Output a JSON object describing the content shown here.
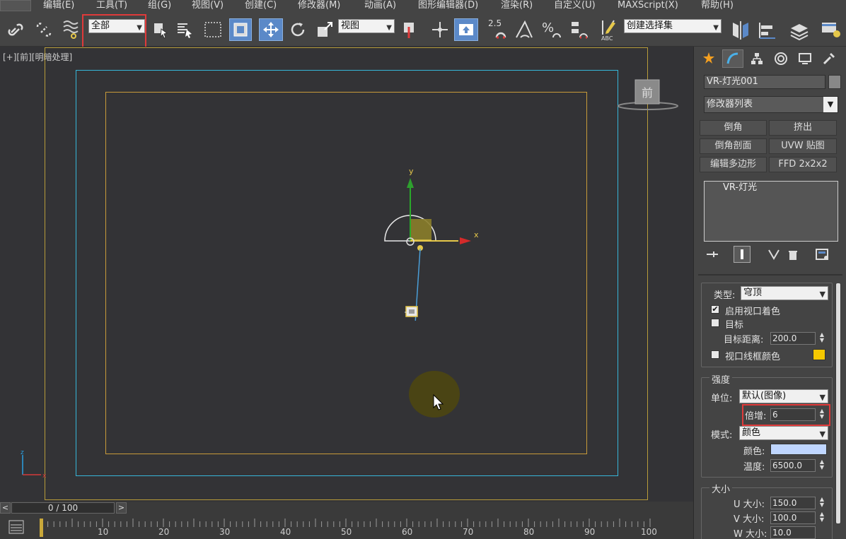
{
  "menu": {
    "items": [
      "编辑(E)",
      "工具(T)",
      "组(G)",
      "视图(V)",
      "创建(C)",
      "修改器(M)",
      "动画(A)",
      "图形编辑器(D)",
      "渲染(R)",
      "自定义(U)",
      "MAXScript(X)",
      "帮助(H)"
    ]
  },
  "toolbar": {
    "selection_filter": "全部",
    "reference_coord": "视图",
    "angle_snap_label": "2.5",
    "percent_label": "%",
    "named_selection": "创建选择集",
    "abc_label": "ABC"
  },
  "viewport": {
    "label": "[+][前][明暗处理]",
    "viewcube_label": "前",
    "axis_x": "x",
    "axis_y": "y",
    "tripod_z": "z",
    "tripod_x": "x"
  },
  "timeslider": {
    "position": "0 / 100",
    "prev": "<",
    "next": ">"
  },
  "trackbar": {
    "ticks": [
      "10",
      "20",
      "30",
      "40",
      "50",
      "60",
      "70",
      "80",
      "90",
      "100"
    ]
  },
  "panel": {
    "object_name": "VR-灯光001",
    "modifier_list": "修改器列表",
    "buttons": [
      "倒角",
      "挤出",
      "倒角剖面",
      "UVW 贴图",
      "编辑多边形",
      "FFD 2x2x2"
    ],
    "stack_item": "VR-灯光",
    "params": {
      "type_label": "类型:",
      "type_value": "穹顶",
      "enable_viewport_shading": "启用视口着色",
      "target": "目标",
      "target_distance_label": "目标距离:",
      "target_distance": "200.0",
      "viewport_wire_color": "视口线框颜色",
      "wire_color": "#f5c800"
    },
    "intensity": {
      "title": "强度",
      "unit_label": "单位:",
      "unit_value": "默认(图像)",
      "multiplier_label": "倍增:",
      "multiplier_value": "6",
      "mode_label": "模式:",
      "mode_value": "颜色",
      "color_label": "颜色:",
      "color_value": "#bfd6ff",
      "temperature_label": "温度:",
      "temperature_value": "6500.0"
    },
    "size": {
      "title": "大小",
      "u_label": "U 大小:",
      "u_value": "150.0",
      "v_label": "V 大小:",
      "v_value": "100.0",
      "w_label": "W 大小:",
      "w_value": "10.0"
    }
  }
}
